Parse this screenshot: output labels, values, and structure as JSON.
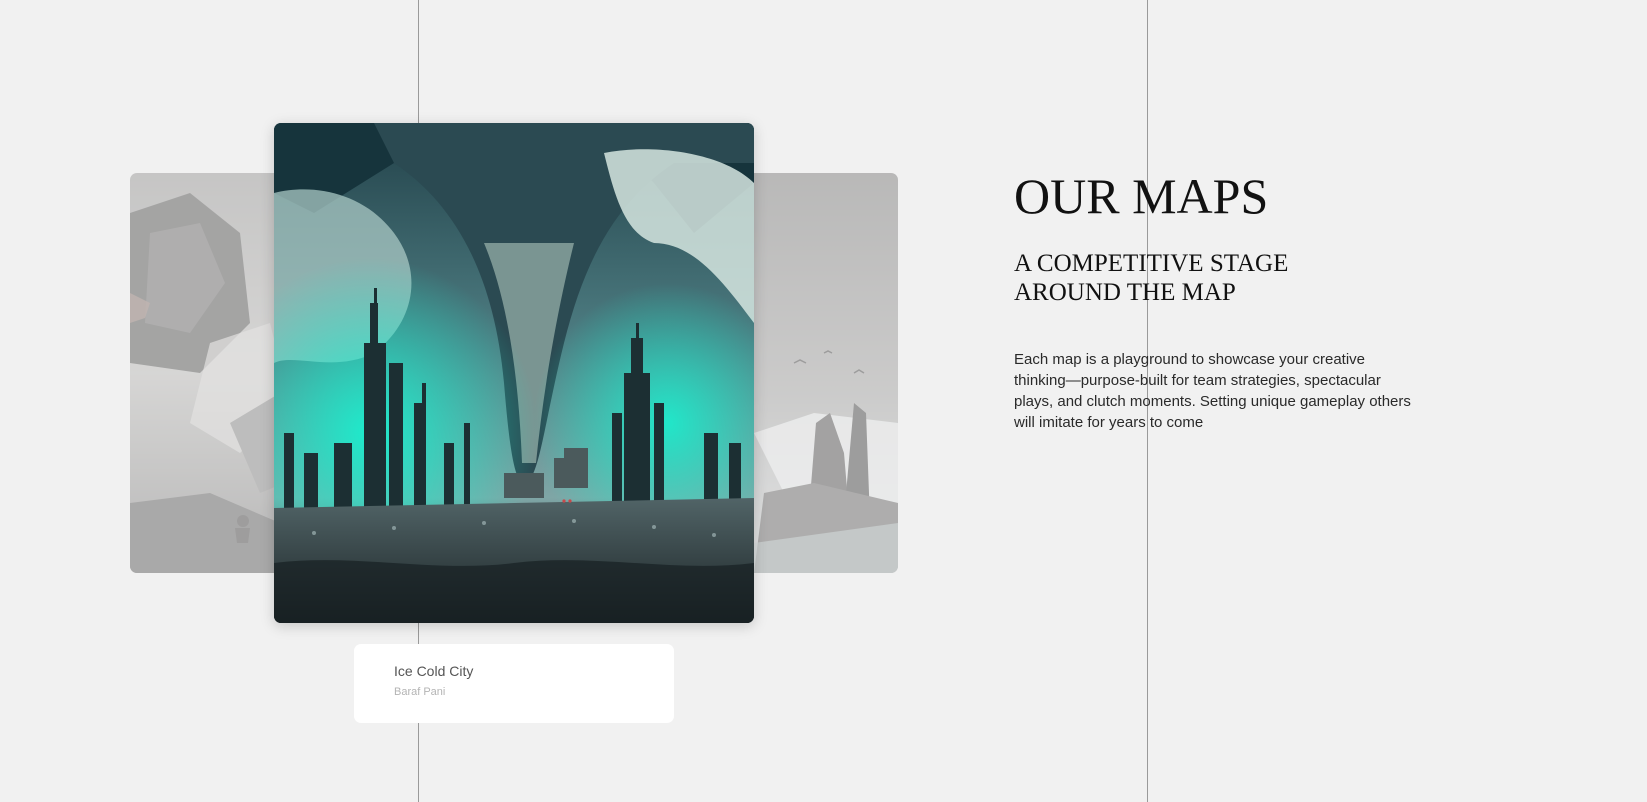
{
  "maps": {
    "current": {
      "name": "Ice Cold City",
      "subtitle": "Baraf Pani"
    },
    "carousel": [
      "mountain-ruins-map-card",
      "ice-cold-city-map-card",
      "frozen-harbor-map-card"
    ]
  },
  "info": {
    "heading": "OUR MAPS",
    "subheading": "A COMPETITIVE STAGE AROUND THE MAP",
    "body": "Each map is a playground to showcase your creative thinking—purpose-built for team strategies, spectacular plays, and clutch moments. Setting unique gameplay others will imitate for years to come"
  },
  "colors": {
    "background": "#f1f1f1",
    "accent_glow": "#19f0cf",
    "card_background": "#ffffff"
  }
}
